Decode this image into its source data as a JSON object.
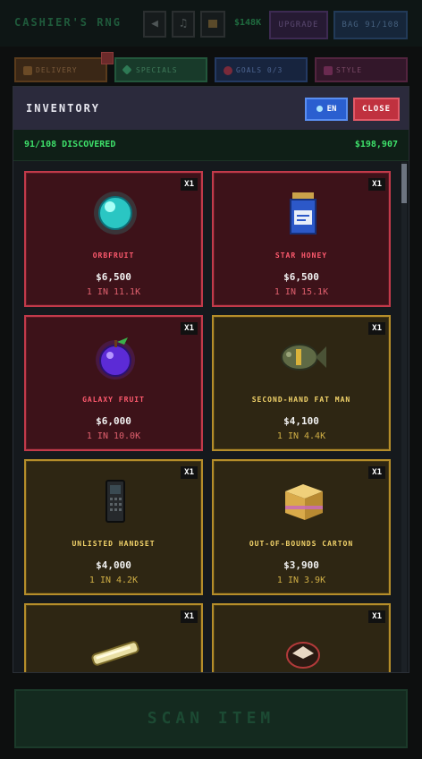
{
  "header": {
    "app_title": "CASHIER'S RNG",
    "money": "$148K",
    "upgrade_label": "UPGRADE",
    "bag_label": "BAG 91/108"
  },
  "tabs": [
    {
      "label": "DELIVERY"
    },
    {
      "label": "SPECIALS"
    },
    {
      "label": "GOALS 0/3"
    },
    {
      "label": "STYLE"
    }
  ],
  "modal": {
    "title": "INVENTORY",
    "lang_label": "EN",
    "close_label": "CLOSE",
    "discovered": "91/108 DISCOVERED",
    "money": "$198,907"
  },
  "items": [
    {
      "name": "ORBFRUIT",
      "price": "$6,500",
      "odds": "1 IN 11.1K",
      "qty": "X1",
      "rarity": "red",
      "icon": "orb-icon"
    },
    {
      "name": "STAR HONEY",
      "price": "$6,500",
      "odds": "1 IN 15.1K",
      "qty": "X1",
      "rarity": "red",
      "icon": "honey-jar-icon"
    },
    {
      "name": "GALAXY FRUIT",
      "price": "$6,000",
      "odds": "1 IN 10.0K",
      "qty": "X1",
      "rarity": "red",
      "icon": "galaxy-fruit-icon"
    },
    {
      "name": "SECOND-HAND FAT MAN",
      "price": "$4,100",
      "odds": "1 IN 4.4K",
      "qty": "X1",
      "rarity": "gold",
      "icon": "bomb-icon"
    },
    {
      "name": "UNLISTED HANDSET",
      "price": "$4,000",
      "odds": "1 IN 4.2K",
      "qty": "X1",
      "rarity": "gold",
      "icon": "handset-icon"
    },
    {
      "name": "OUT-OF-BOUNDS CARTON",
      "price": "$3,900",
      "odds": "1 IN 3.9K",
      "qty": "X1",
      "rarity": "gold",
      "icon": "carton-icon"
    },
    {
      "name": "",
      "price": "",
      "odds": "",
      "qty": "X1",
      "rarity": "gold",
      "icon": "tube-icon"
    },
    {
      "name": "",
      "price": "",
      "odds": "",
      "qty": "X1",
      "rarity": "gold",
      "icon": "dish-icon"
    }
  ],
  "footer": {
    "scan_label": "SCAN ITEM"
  },
  "colors": {
    "rare_red": "#c23a4a",
    "rare_gold": "#b58d2a",
    "money_green": "#3ee06a",
    "en_blue": "#2a5fd0",
    "close_red": "#c0313f"
  }
}
